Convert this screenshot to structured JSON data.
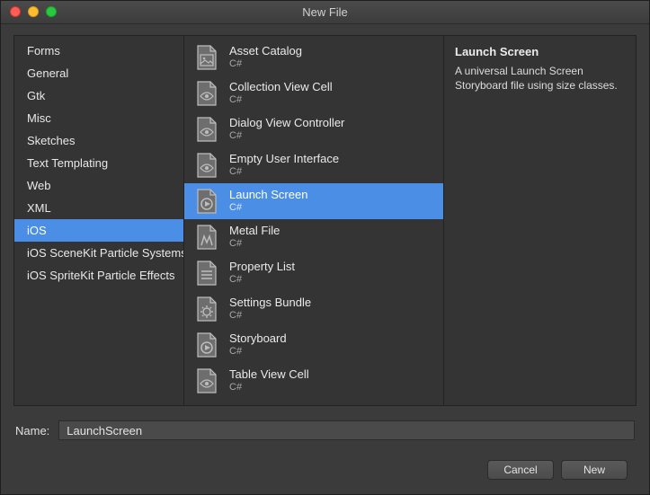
{
  "window": {
    "title": "New File"
  },
  "categories": [
    "Forms",
    "General",
    "Gtk",
    "Misc",
    "Sketches",
    "Text Templating",
    "Web",
    "XML",
    "iOS",
    "iOS SceneKit Particle Systems",
    "iOS SpriteKit Particle Effects"
  ],
  "selectedCategory": "iOS",
  "templates": [
    {
      "title": "Asset Catalog",
      "sub": "C#",
      "icon": "doc-asset"
    },
    {
      "title": "Collection View Cell",
      "sub": "C#",
      "icon": "doc-eye"
    },
    {
      "title": "Dialog View Controller",
      "sub": "C#",
      "icon": "doc-eye"
    },
    {
      "title": "Empty User Interface",
      "sub": "C#",
      "icon": "doc-eye"
    },
    {
      "title": "Launch Screen",
      "sub": "C#",
      "icon": "doc-play"
    },
    {
      "title": "Metal File",
      "sub": "C#",
      "icon": "doc-metal"
    },
    {
      "title": "Property List",
      "sub": "C#",
      "icon": "doc-list"
    },
    {
      "title": "Settings Bundle",
      "sub": "C#",
      "icon": "doc-gear"
    },
    {
      "title": "Storyboard",
      "sub": "C#",
      "icon": "doc-play"
    },
    {
      "title": "Table View Cell",
      "sub": "C#",
      "icon": "doc-eye"
    }
  ],
  "selectedTemplate": "Launch Screen",
  "description": {
    "title": "Launch Screen",
    "body": "A universal Launch Screen Storyboard file using size classes."
  },
  "name_row": {
    "label": "Name:",
    "value": "LaunchScreen"
  },
  "buttons": {
    "cancel": "Cancel",
    "new": "New"
  }
}
